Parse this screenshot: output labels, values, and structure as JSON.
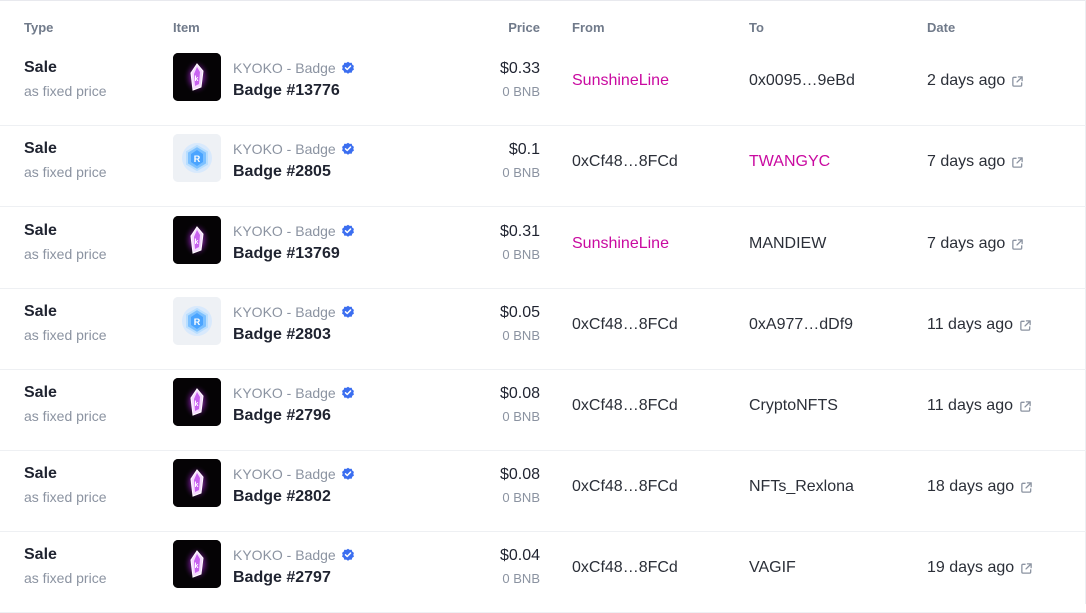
{
  "headers": {
    "type": "Type",
    "item": "Item",
    "price": "Price",
    "from": "From",
    "to": "To",
    "date": "Date"
  },
  "colors": {
    "link": "#c90aa0",
    "verified": "#3b6ef0",
    "muted": "#8b93a1"
  },
  "rows": [
    {
      "type": "Sale",
      "type_sub": "as fixed price",
      "thumb": "dark-crystal",
      "collection": "KYOKO - Badge",
      "item": "Badge #13776",
      "price_usd": "$0.33",
      "price_bnb": "0 BNB",
      "from": "SunshineLine",
      "from_link": true,
      "to": "0x0095…9eBd",
      "to_link": false,
      "date": "2 days ago"
    },
    {
      "type": "Sale",
      "type_sub": "as fixed price",
      "thumb": "light-hexagon",
      "collection": "KYOKO - Badge",
      "item": "Badge #2805",
      "price_usd": "$0.1",
      "price_bnb": "0 BNB",
      "from": "0xCf48…8FCd",
      "from_link": false,
      "to": "TWANGYC",
      "to_link": true,
      "date": "7 days ago"
    },
    {
      "type": "Sale",
      "type_sub": "as fixed price",
      "thumb": "dark-crystal",
      "collection": "KYOKO - Badge",
      "item": "Badge #13769",
      "price_usd": "$0.31",
      "price_bnb": "0 BNB",
      "from": "SunshineLine",
      "from_link": true,
      "to": "MANDIEW",
      "to_link": false,
      "date": "7 days ago"
    },
    {
      "type": "Sale",
      "type_sub": "as fixed price",
      "thumb": "light-hexagon",
      "collection": "KYOKO - Badge",
      "item": "Badge #2803",
      "price_usd": "$0.05",
      "price_bnb": "0 BNB",
      "from": "0xCf48…8FCd",
      "from_link": false,
      "to": "0xA977…dDf9",
      "to_link": false,
      "date": "11 days ago"
    },
    {
      "type": "Sale",
      "type_sub": "as fixed price",
      "thumb": "dark-crystal",
      "collection": "KYOKO - Badge",
      "item": "Badge #2796",
      "price_usd": "$0.08",
      "price_bnb": "0 BNB",
      "from": "0xCf48…8FCd",
      "from_link": false,
      "to": "CryptoNFTS",
      "to_link": false,
      "date": "11 days ago"
    },
    {
      "type": "Sale",
      "type_sub": "as fixed price",
      "thumb": "dark-crystal",
      "collection": "KYOKO - Badge",
      "item": "Badge #2802",
      "price_usd": "$0.08",
      "price_bnb": "0 BNB",
      "from": "0xCf48…8FCd",
      "from_link": false,
      "to": "NFTs_Rexlona",
      "to_link": false,
      "date": "18 days ago"
    },
    {
      "type": "Sale",
      "type_sub": "as fixed price",
      "thumb": "dark-crystal",
      "collection": "KYOKO - Badge",
      "item": "Badge #2797",
      "price_usd": "$0.04",
      "price_bnb": "0 BNB",
      "from": "0xCf48…8FCd",
      "from_link": false,
      "to": "VAGIF",
      "to_link": false,
      "date": "19 days ago"
    }
  ]
}
